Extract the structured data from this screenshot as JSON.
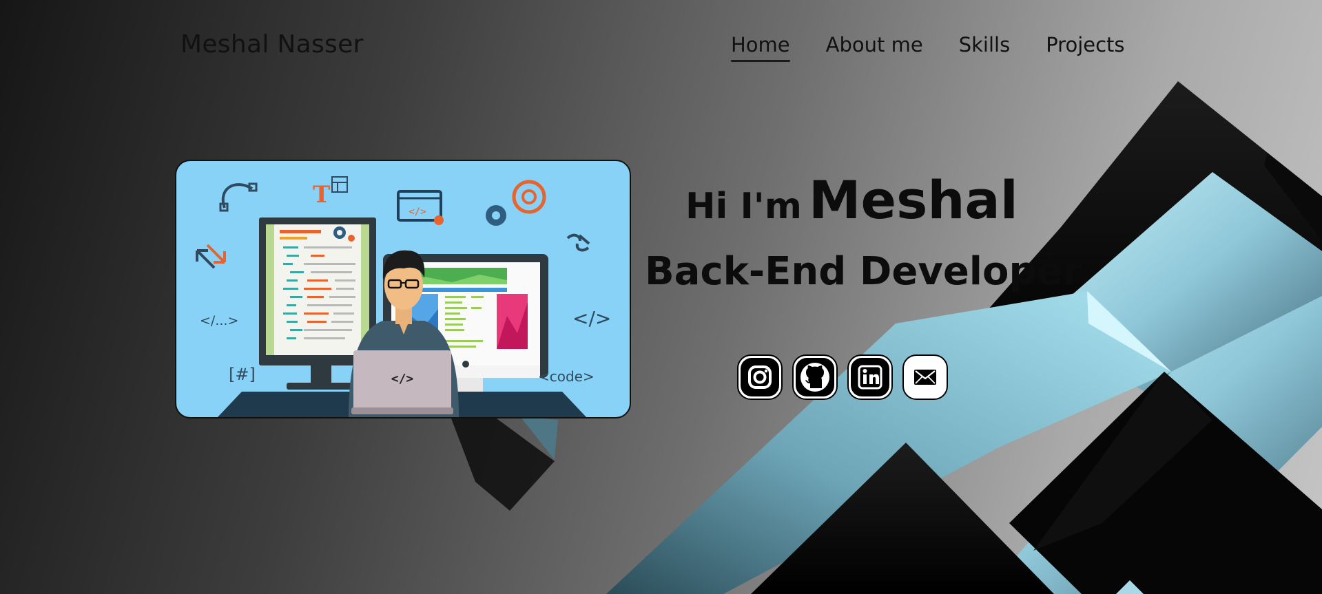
{
  "header": {
    "brand": "Meshal Nasser",
    "nav": [
      {
        "label": "Home",
        "active": true
      },
      {
        "label": "About me",
        "active": false
      },
      {
        "label": "Skills",
        "active": false
      },
      {
        "label": "Projects",
        "active": false
      }
    ]
  },
  "hero": {
    "greeting": "Hi I'm",
    "name": "Meshal",
    "role": "Back-End Developer",
    "illustration": {
      "labels": {
        "tag_dots": "</...>",
        "tag_close": "</>",
        "hash": "[#]",
        "code": "<code>",
        "laptop": "</>",
        "window_tag": "</>",
        "letter_t": "T"
      }
    }
  },
  "socials": [
    {
      "icon": "instagram-icon",
      "label": "Instagram"
    },
    {
      "icon": "github-icon",
      "label": "GitHub"
    },
    {
      "icon": "linkedin-icon",
      "label": "LinkedIn"
    },
    {
      "icon": "mail-icon",
      "label": "Email"
    }
  ],
  "colors": {
    "card_bg": "#87d2f6",
    "accent_orange": "#e8632d",
    "text_dark": "#0c0c0c"
  }
}
